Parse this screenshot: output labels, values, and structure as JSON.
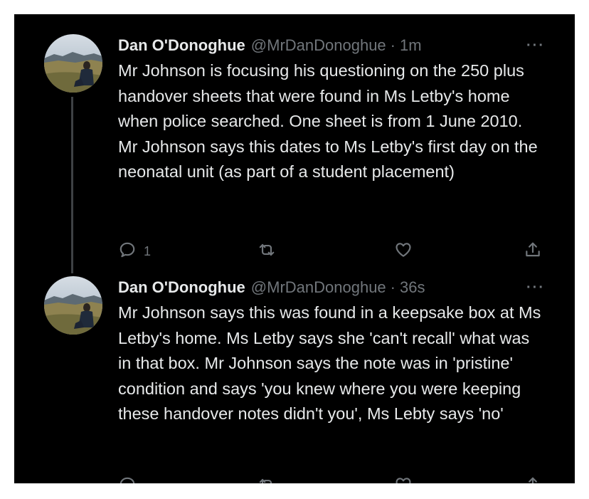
{
  "tweets": [
    {
      "name": "Dan O'Donoghue",
      "handle": "@MrDanDonoghue",
      "separator": "·",
      "time": "1m",
      "text": "Mr Johnson is focusing his questioning on the 250 plus handover sheets that were found in Ms Letby's home when police searched. One sheet is from 1 June 2010. Mr Johnson says this dates to Ms Letby's first day on the neonatal unit (as part of a student placement)",
      "reply_count": "1"
    },
    {
      "name": "Dan O'Donoghue",
      "handle": "@MrDanDonoghue",
      "separator": "·",
      "time": "36s",
      "text": "Mr Johnson says this was found in a keepsake box at Ms Letby's home. Ms Letby says she 'can't recall' what was in that box. Mr Johnson says the note was in 'pristine' condition and says 'you knew where you were keeping these handover notes didn't you', Ms Lebty says 'no'"
    }
  ],
  "more_label": "···",
  "icons": {
    "reply": "reply-bubble-icon",
    "retweet": "retweet-icon",
    "like": "heart-icon",
    "share": "share-upload-icon",
    "more": "more-options-icon"
  },
  "colors": {
    "background": "#000000",
    "primary_text": "#e7e9ea",
    "secondary_text": "#71767b",
    "thread_line": "#3e4144"
  }
}
